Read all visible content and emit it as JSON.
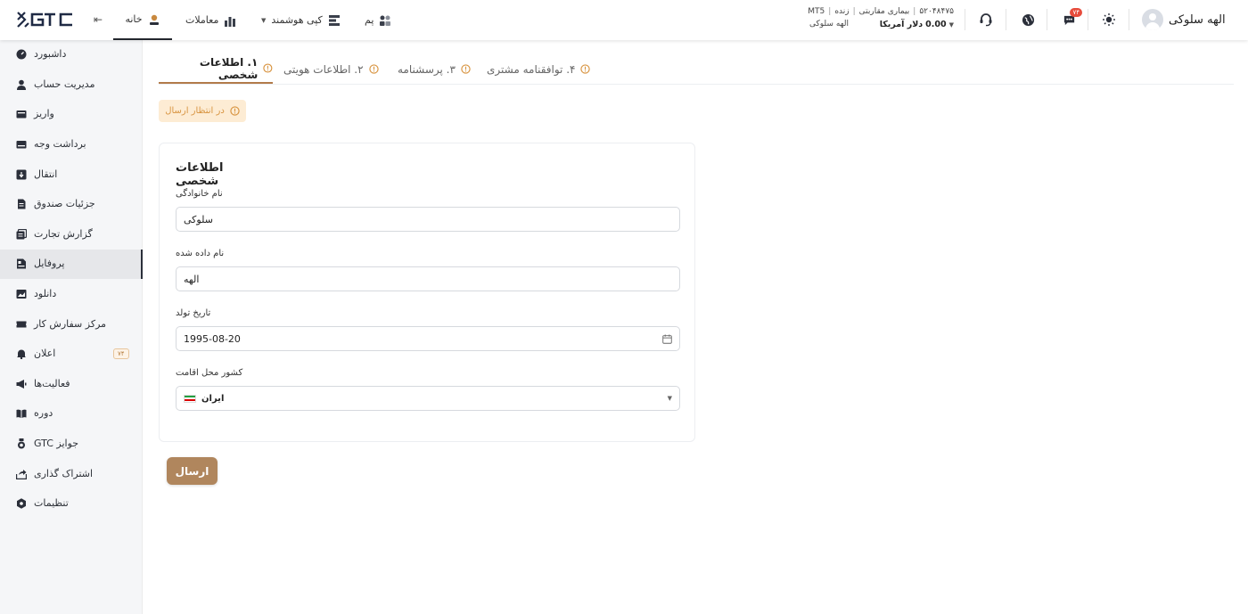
{
  "header": {
    "logo_text": "GTC",
    "nav": [
      {
        "label": "خانه",
        "icon": "home-icon",
        "active": true
      },
      {
        "label": "معاملات",
        "icon": "chart-icon",
        "active": false
      },
      {
        "label": "کپی هوشمند",
        "icon": "copy-icon",
        "active": false,
        "has_dropdown": true
      },
      {
        "label": "پم",
        "icon": "pamm-icon",
        "active": false
      }
    ],
    "account": {
      "number": "۵۲۰۴۸۴۷۵",
      "type": "بیماری مقاربتی",
      "status": "زنده",
      "platform": "MT5",
      "balance": "0.00",
      "currency": "دلار آمریکا",
      "holder": "الهه سلوکی"
    },
    "notification_count": "۷۴",
    "user_name": "الهه سلوکی"
  },
  "sidebar": {
    "items": [
      {
        "label": "داشبورد",
        "icon": "dashboard-icon"
      },
      {
        "label": "مدیریت حساب",
        "icon": "user-icon"
      },
      {
        "label": "واریز",
        "icon": "wallet-icon"
      },
      {
        "label": "برداشت وجه",
        "icon": "withdraw-icon"
      },
      {
        "label": "انتقال",
        "icon": "transfer-icon"
      },
      {
        "label": "جزئیات صندوق",
        "icon": "document-icon"
      },
      {
        "label": "گزارش تجارت",
        "icon": "report-icon"
      },
      {
        "label": "پروفایل",
        "icon": "profile-icon",
        "active": true
      },
      {
        "label": "دانلود",
        "icon": "download-icon"
      },
      {
        "label": "مرکز سفارش کار",
        "icon": "ticket-icon"
      },
      {
        "label": "اعلان",
        "icon": "bell-icon",
        "badge": "۷۴"
      },
      {
        "label": "فعالیت‌ها",
        "icon": "megaphone-icon"
      },
      {
        "label": "دوره",
        "icon": "book-icon"
      },
      {
        "label": "جوایز GTC",
        "icon": "medal-icon"
      },
      {
        "label": "اشتراک گذاری",
        "icon": "share-icon"
      },
      {
        "label": "تنظیمات",
        "icon": "settings-icon"
      }
    ]
  },
  "tabs": [
    {
      "label": "۱. اطلاعات شخصی",
      "active": true
    },
    {
      "label": "۲. اطلاعات هویتی",
      "active": false
    },
    {
      "label": "۳. پرسشنامه",
      "active": false
    },
    {
      "label": "۴. توافقنامه مشتری",
      "active": false
    }
  ],
  "status": "در انتظار ارسال",
  "form": {
    "title": "اطلاعات شخصی",
    "last_name_label": "نام خانوادگی",
    "last_name_value": "سلوکی",
    "first_name_label": "نام داده شده",
    "first_name_value": "الهه",
    "birth_date_label": "تاریخ تولد",
    "birth_date_value": "1995-08-20",
    "country_label": "کشور محل اقامت",
    "country_value": "ایران"
  },
  "submit_label": "ارسال",
  "colors": {
    "accent": "#b0865d",
    "tab_underline": "#b27b4a",
    "warning": "#d89440",
    "warning_bg": "#fdecd4"
  }
}
